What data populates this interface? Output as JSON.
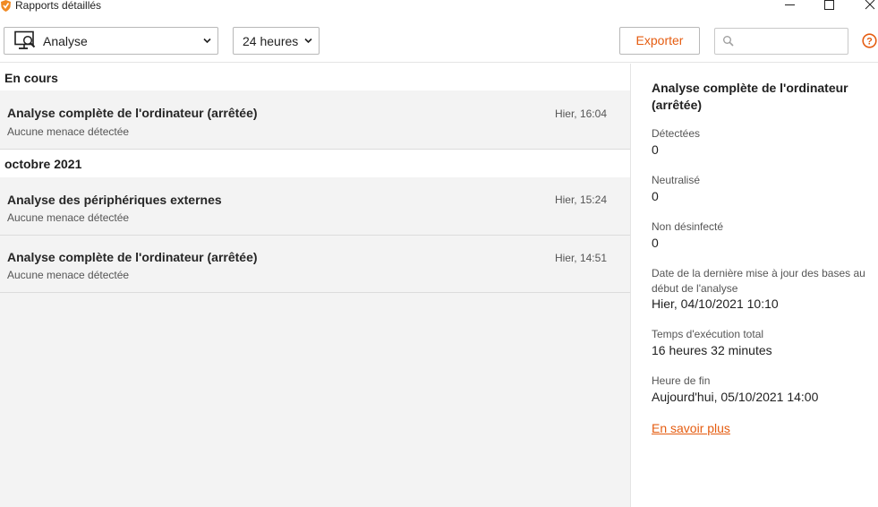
{
  "window": {
    "title": "Rapports détaillés",
    "icons": [
      "app-shield-icon",
      "minimize-icon",
      "maximize-icon",
      "close-icon"
    ]
  },
  "toolbar": {
    "type_select": {
      "value": "Analyse",
      "icon": "monitor-scan-icon"
    },
    "period_select": {
      "value": "24 heures"
    },
    "export_label": "Exporter",
    "search": {
      "value": "",
      "placeholder": ""
    },
    "help_icon": "help-icon"
  },
  "list": {
    "groups": [
      {
        "header": "En cours",
        "items": [
          {
            "title": "Analyse complète de l'ordinateur (arrêtée)",
            "subtitle": "Aucune menace détectée",
            "time": "Hier, 16:04"
          }
        ]
      },
      {
        "header": "octobre 2021",
        "items": [
          {
            "title": "Analyse des périphériques externes",
            "subtitle": "Aucune menace détectée",
            "time": "Hier, 15:24"
          },
          {
            "title": "Analyse complète de l'ordinateur (arrêtée)",
            "subtitle": "Aucune menace détectée",
            "time": "Hier, 14:51"
          }
        ]
      }
    ]
  },
  "details": {
    "title": "Analyse complète de l'ordinateur (arrêtée)",
    "fields": [
      {
        "label": "Détectées",
        "value": "0"
      },
      {
        "label": "Neutralisé",
        "value": "0"
      },
      {
        "label": "Non désinfecté",
        "value": "0"
      },
      {
        "label": "Date de la dernière mise à jour des bases au début de l'analyse",
        "value": "Hier, 04/10/2021 10:10"
      },
      {
        "label": "Temps d'exécution total",
        "value": "16 heures 32 minutes"
      },
      {
        "label": "Heure de fin",
        "value": "Aujourd'hui, 05/10/2021 14:00"
      }
    ],
    "link": "En savoir plus"
  },
  "colors": {
    "accent": "#e55c10",
    "list_background": "#f3f3f3",
    "border": "#b8b8b8"
  }
}
